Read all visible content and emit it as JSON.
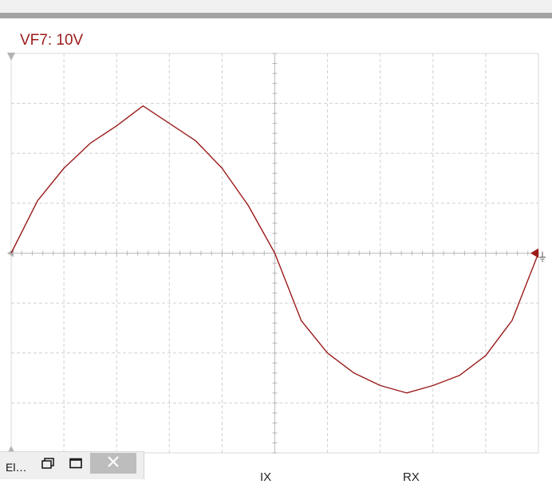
{
  "channel": {
    "label": "VF7: 10V",
    "color": "#9b1b1b"
  },
  "window": {
    "title_truncated": "El…",
    "restore_icon": "restore-window-icon",
    "maximize_icon": "maximize-window-icon",
    "close_icon": "close-icon"
  },
  "cursors": {
    "left": "IX",
    "right": "RX"
  },
  "chart_data": {
    "type": "line",
    "grid": true,
    "x_divisions": 10,
    "y_divisions": 8,
    "xlim": [
      0,
      10
    ],
    "ylim": [
      -4,
      4
    ],
    "series": [
      {
        "x": [
          0,
          0.5,
          1,
          1.5,
          2,
          2.5,
          3,
          3.5,
          4,
          4.5,
          5,
          5.5,
          6,
          6.5,
          7,
          7.5,
          8,
          8.5,
          9,
          9.5,
          10
        ],
        "y": [
          0,
          1.05,
          1.7,
          2.2,
          2.55,
          2.95,
          2.6,
          2.25,
          1.7,
          0.95,
          0,
          -1.35,
          -2.0,
          -2.4,
          -2.65,
          -2.8,
          -2.65,
          -2.45,
          -2.05,
          -1.35,
          0
        ]
      }
    ]
  }
}
